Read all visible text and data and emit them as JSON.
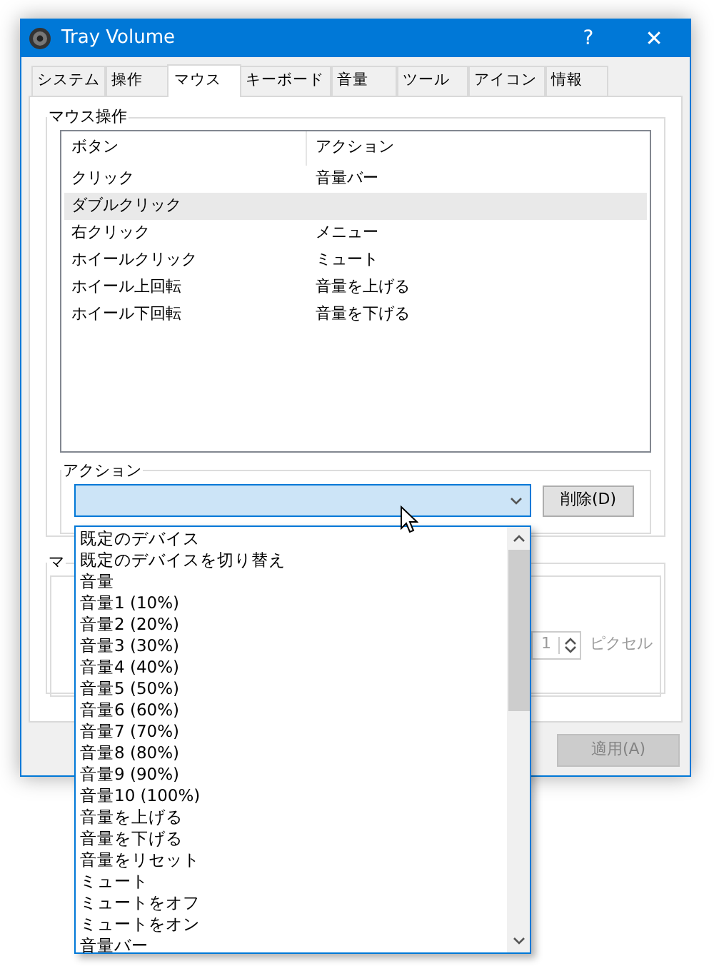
{
  "window": {
    "title": "Tray Volume",
    "help": "?",
    "close": "✕"
  },
  "tabs": [
    {
      "label": "システム",
      "selected": false
    },
    {
      "label": "操作",
      "selected": false
    },
    {
      "label": "マウス",
      "selected": true
    },
    {
      "label": "キーボード",
      "selected": false
    },
    {
      "label": "音量",
      "selected": false
    },
    {
      "label": "ツール",
      "selected": false
    },
    {
      "label": "アイコン",
      "selected": false
    },
    {
      "label": "情報",
      "selected": false
    }
  ],
  "mouse_group": {
    "title": "マウス操作",
    "columns": [
      "ボタン",
      "アクション"
    ],
    "rows": [
      {
        "button": "クリック",
        "action": "音量バー",
        "selected": false
      },
      {
        "button": "ダブルクリック",
        "action": "",
        "selected": true
      },
      {
        "button": "右クリック",
        "action": "メニュー",
        "selected": false
      },
      {
        "button": "ホイールクリック",
        "action": "ミュート",
        "selected": false
      },
      {
        "button": "ホイール上回転",
        "action": "音量を上げる",
        "selected": false
      },
      {
        "button": "ホイール下回転",
        "action": "音量を下げる",
        "selected": false
      }
    ]
  },
  "action_group": {
    "title": "アクション",
    "delete_button": "削除(D)"
  },
  "second_group": {
    "title": "マ",
    "spinner_value": "1",
    "spinner_unit": "ピクセル",
    "disabled": true
  },
  "apply_button": {
    "label": "適用(A)",
    "disabled": true
  },
  "dropdown": {
    "items": [
      "既定のデバイス",
      "既定のデバイスを切り替え",
      "音量",
      "音量1 (10%)",
      "音量2 (20%)",
      "音量3 (30%)",
      "音量4 (40%)",
      "音量5 (50%)",
      "音量6 (60%)",
      "音量7 (70%)",
      "音量8 (80%)",
      "音量9 (90%)",
      "音量10 (100%)",
      "音量を上げる",
      "音量を下げる",
      "音量をリセット",
      "ミュート",
      "ミュートをオフ",
      "ミュートをオン",
      "音量バー"
    ]
  }
}
